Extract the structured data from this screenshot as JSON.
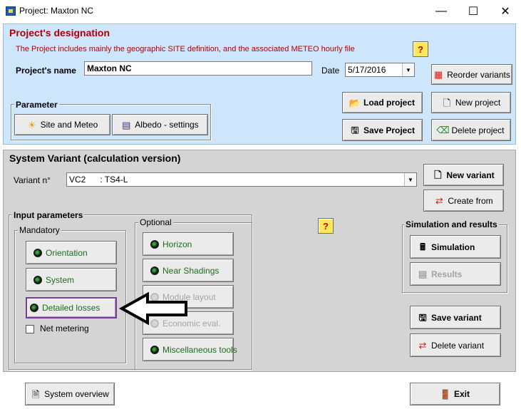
{
  "window": {
    "title": "Project:  Maxton NC",
    "minimize_glyph": "—",
    "maximize_glyph": "☐",
    "close_glyph": "✕"
  },
  "project": {
    "section_title": "Project's designation",
    "description": "The Project includes mainly the geographic SITE definition, and the associated  METEO  hourly file",
    "help_label": "?",
    "name_label": "Project's name",
    "name_value": "Maxton NC",
    "date_label": "Date",
    "date_value": "5/17/2016",
    "parameter_group_title": "Parameter",
    "buttons": {
      "site_meteo": "Site and Meteo",
      "albedo": "Albedo - settings",
      "load_project": "Load project",
      "save_project": "Save Project",
      "reorder_variants": "Reorder variants",
      "new_project": "New project",
      "delete_project": "Delete project"
    }
  },
  "system": {
    "section_title": "System Variant (calculation version)",
    "variant_label": "Variant n°",
    "variant_value": "VC2      : TS4-L",
    "help_label": "?",
    "input_params_title": "Input parameters",
    "mandatory_title": "Mandatory",
    "optional_title": "Optional",
    "mandatory_buttons": {
      "orientation": "Orientation",
      "system": "System",
      "detailed_losses": "Detailed losses"
    },
    "net_metering_label": "Net metering",
    "optional_buttons": {
      "horizon": "Horizon",
      "near_shadings": "Near Shadings",
      "module_layout": "Module layout",
      "economic_eval": "Economic eval.",
      "misc_tools": "Miscellaneous tools"
    },
    "new_variant": "New variant",
    "create_from": "Create from",
    "sim_results_title": "Simulation and results",
    "simulation": "Simulation",
    "results": "Results",
    "save_variant": "Save variant",
    "delete_variant": "Delete variant"
  },
  "footer": {
    "system_overview": "System overview",
    "exit": "Exit"
  },
  "colors": {
    "project_panel_bg": "#cde6fc",
    "system_panel_bg": "#d4d4d4",
    "section_title_red": "#b20000",
    "optional_text_green": "#1b6e1b"
  }
}
